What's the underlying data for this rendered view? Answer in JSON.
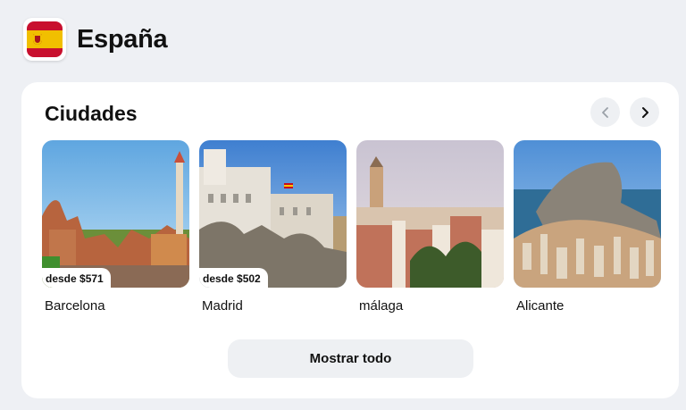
{
  "header": {
    "title": "España",
    "flag_icon": "spain-flag-icon",
    "flag_colors": {
      "red": "#c8102e",
      "yellow": "#f1bf00"
    }
  },
  "section": {
    "title": "Ciudades",
    "prev_icon": "chevron-left-icon",
    "next_icon": "chevron-right-icon"
  },
  "cities": [
    {
      "name": "Barcelona",
      "price": "desde $571"
    },
    {
      "name": "Madrid",
      "price": "desde $502"
    },
    {
      "name": "málaga",
      "price": ""
    },
    {
      "name": "Alicante",
      "price": ""
    }
  ],
  "show_all_label": "Mostrar todo"
}
